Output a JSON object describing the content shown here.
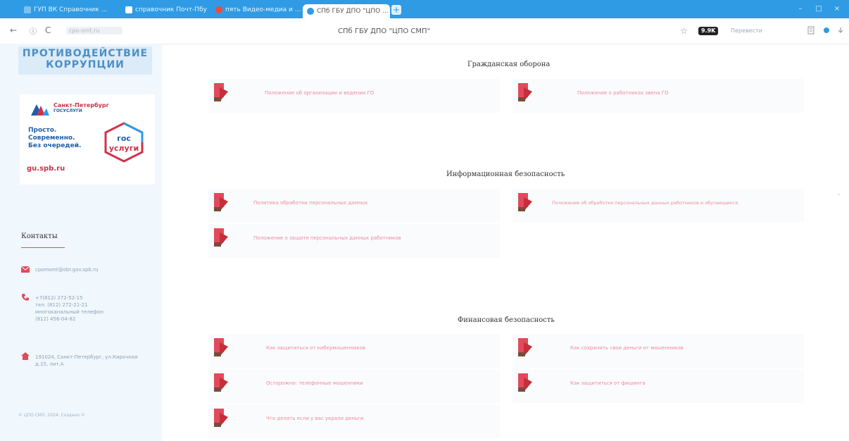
{
  "browser": {
    "tabs": [
      {
        "label": "ГУП ВК Справочник ...",
        "active": false
      },
      {
        "label": "справочник Почт-Пбу",
        "active": false
      },
      {
        "label": "пять Видео-медиа и ...",
        "active": false
      },
      {
        "label": "СПб ГБУ ДПО \"ЦПО ...",
        "active": true
      }
    ],
    "tab_close": "×",
    "new_tab": "+",
    "window_controls": [
      "–",
      "□",
      "×"
    ],
    "url": "cpo-smt.ru",
    "page_title": "СПб ГБУ ДПО \"ЦПО СМП\"",
    "ext_badge": "9.9K",
    "translate_label": "Перевести",
    "nav": {
      "back": "←",
      "reload": "C",
      "info": "ⓘ"
    },
    "star": "☆"
  },
  "sidebar": {
    "banner_line1": "ПРОТИВОДЕЙСТВИЕ",
    "banner_line2": "КОРРУПЦИИ",
    "gu": {
      "city": "Санкт-Петербург",
      "services": "ГОСУСЛУГИ",
      "slogan_1": "Просто.",
      "slogan_2": "Современно.",
      "slogan_3": "Без очередей.",
      "hex_line1": "гос",
      "hex_line2": "услуги",
      "url": "gu.spb.ru"
    },
    "contacts_title": "Контакты",
    "email": "cpomsmt@obr.gov.spb.ru",
    "phones": [
      "+7(812) 272-52-15",
      "тел. (812) 272-21-21",
      "многоканальный телефон",
      "(812) 456-04-82"
    ],
    "address_1": "191024, Санкт-Петербург, ул.Кирочная",
    "address_2": "д.15, лит.А",
    "copyright": "© ЦПО СМП, 2024. Создано ©",
    "icons": {
      "email": "envelope-icon",
      "phone": "phone-icon",
      "address": "home-icon"
    }
  },
  "main": {
    "sections": [
      {
        "title": "Гражданская оборона",
        "docs": [
          "Положение об организации и ведении ГО",
          "Положение о работниках звена ГО"
        ]
      },
      {
        "title": "Информационная безопасность",
        "docs": [
          "Политика обработки персональных данных",
          "Положение об обработке персональных данных работников и обучающихся",
          "Положение о защите персональных данных работников"
        ]
      },
      {
        "title": "Финансовая безопасность",
        "docs": [
          "Как защититься от кибермошенников",
          "Как сохранить свои деньги от мошенников",
          "Осторожно: телефонные мошенники",
          "Как защититься от фишинга",
          "Что делать если у вас украли деньги"
        ]
      }
    ],
    "doc_icon": "pdf-document-icon"
  },
  "colors": {
    "tabbar": "#2f9be4",
    "sidebar_bg": "#f0f7fd",
    "accent_red": "#e14a5c",
    "link_pink": "#f08a9a",
    "gu_blue": "#1f5fa8"
  }
}
